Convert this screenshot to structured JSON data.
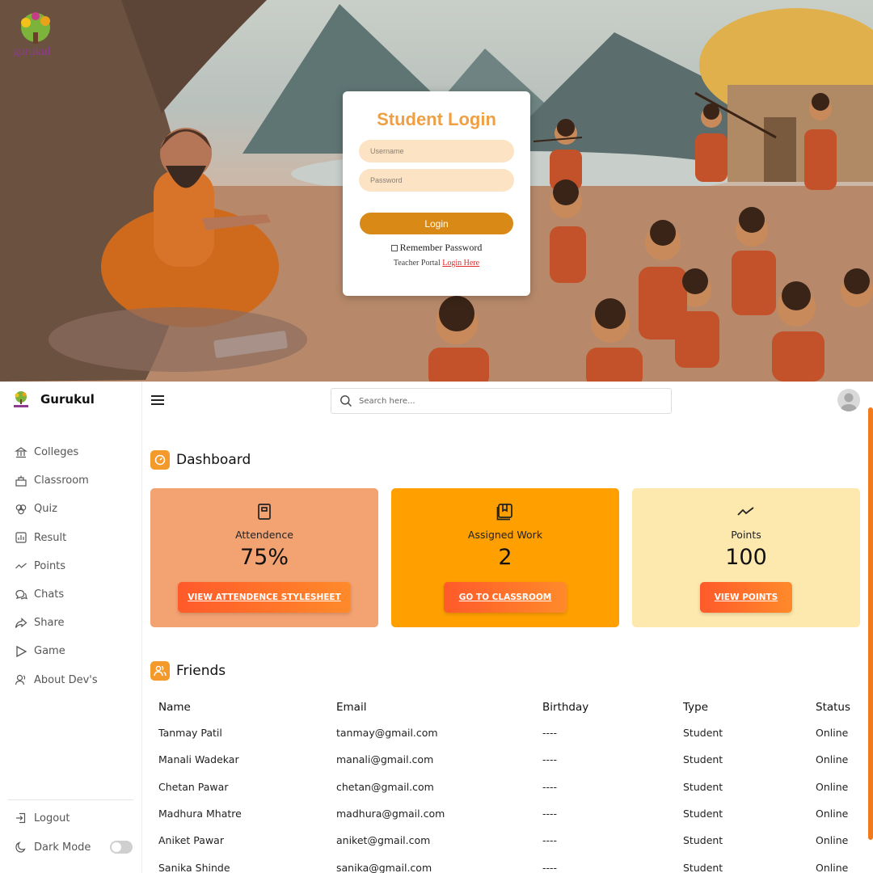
{
  "login": {
    "title": "Student Login",
    "username_placeholder": "Username",
    "password_placeholder": "Password",
    "login_label": "Login",
    "remember_label": "Remember Password",
    "teacher_text": "Teacher Portal",
    "teacher_link": "Login Here",
    "logo_text": "gurukul"
  },
  "brand": {
    "name": "Gurukul"
  },
  "sidebar": {
    "items": [
      {
        "label": "Colleges",
        "icon": "bank-icon"
      },
      {
        "label": "Classroom",
        "icon": "classroom-icon"
      },
      {
        "label": "Quiz",
        "icon": "quiz-icon"
      },
      {
        "label": "Result",
        "icon": "chart-icon"
      },
      {
        "label": "Points",
        "icon": "trend-icon"
      },
      {
        "label": "Chats",
        "icon": "chat-icon"
      },
      {
        "label": "Share",
        "icon": "share-icon"
      },
      {
        "label": "Game",
        "icon": "play-icon"
      },
      {
        "label": "About Dev's",
        "icon": "users-icon"
      }
    ],
    "logout_label": "Logout",
    "dark_mode_label": "Dark Mode",
    "dark_mode_on": false
  },
  "search": {
    "placeholder": "Search here..."
  },
  "dashboard": {
    "title": "Dashboard",
    "cards": [
      {
        "label": "Attendence",
        "value": "75%",
        "button": "VIEW ATTENDENCE STYLESHEET",
        "color": "#f3a272"
      },
      {
        "label": "Assigned Work",
        "value": "2",
        "button": "GO TO CLASSROOM",
        "color": "#ffa000"
      },
      {
        "label": "Points",
        "value": "100",
        "button": "VIEW POINTS",
        "color": "#fde9ad"
      }
    ]
  },
  "friends": {
    "title": "Friends",
    "columns": [
      "Name",
      "Email",
      "Birthday",
      "Type",
      "Status"
    ],
    "rows": [
      [
        "Tanmay Patil",
        "tanmay@gmail.com",
        "----",
        "Student",
        "Online"
      ],
      [
        "Manali Wadekar",
        "manali@gmail.com",
        "----",
        "Student",
        "Online"
      ],
      [
        "Chetan Pawar",
        "chetan@gmail.com",
        "----",
        "Student",
        "Online"
      ],
      [
        "Madhura Mhatre",
        "madhura@gmail.com",
        "----",
        "Student",
        "Online"
      ],
      [
        "Aniket Pawar",
        "aniket@gmail.com",
        "----",
        "Student",
        "Online"
      ],
      [
        "Sanika Shinde",
        "sanika@gmail.com",
        "----",
        "Student",
        "Online"
      ]
    ]
  },
  "colors": {
    "accent": "#f39a2b",
    "login_button": "#d98a16",
    "login_title": "#f0a044",
    "input_bg": "#fbe3c4",
    "cta_gradient_start": "#ff5a2a",
    "cta_gradient_end": "#ff8a2a"
  }
}
